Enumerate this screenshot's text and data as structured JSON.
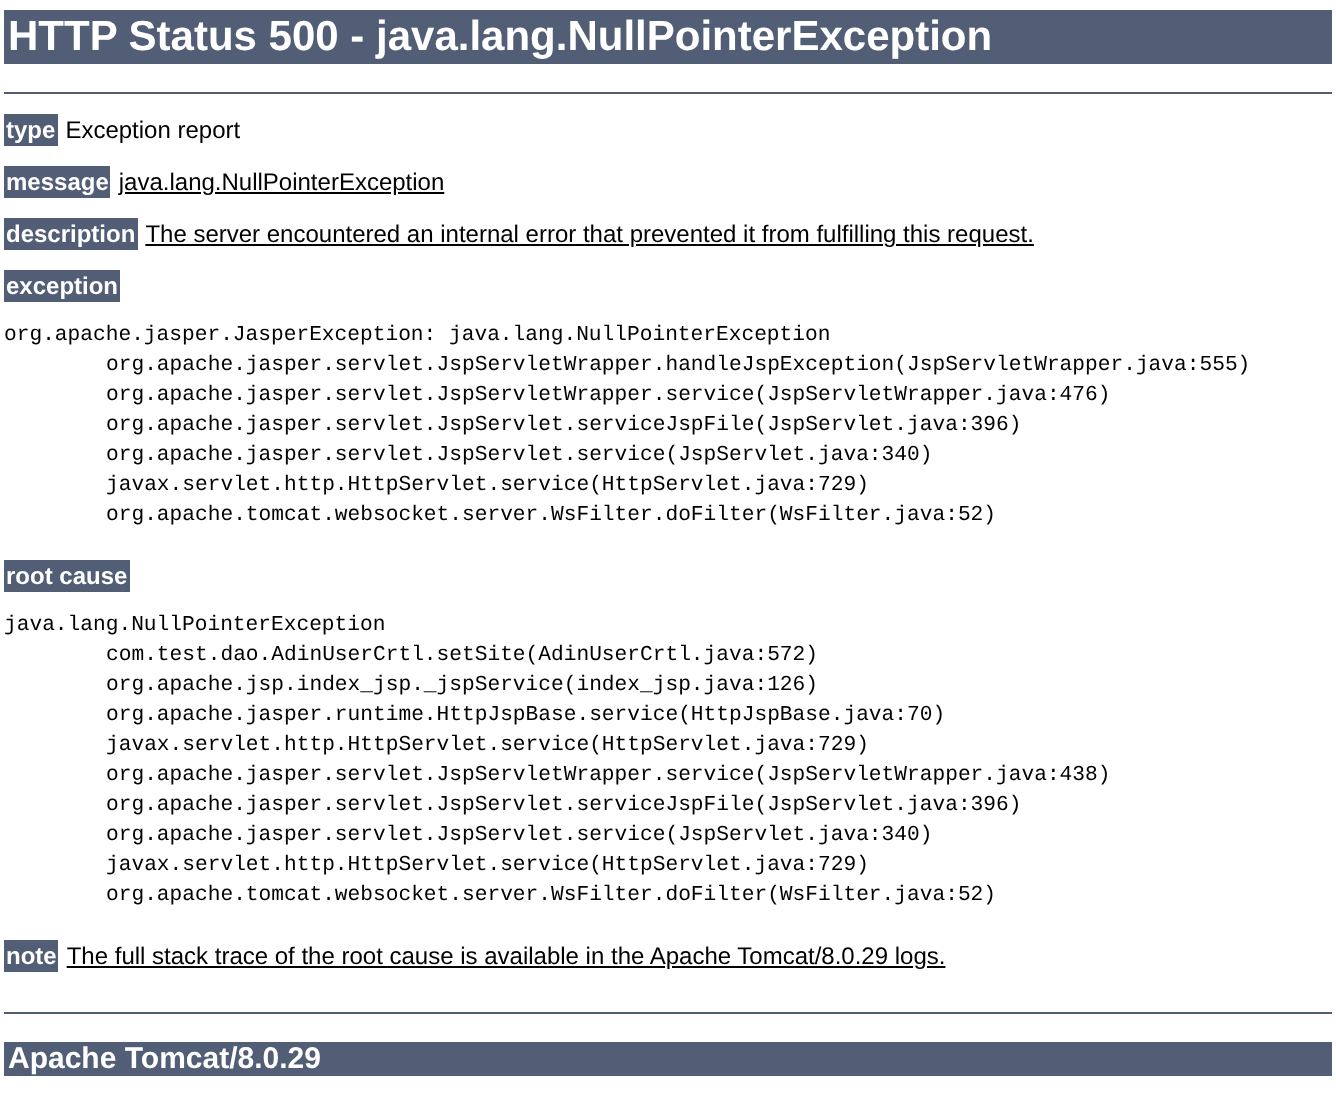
{
  "title": "HTTP Status 500 - java.lang.NullPointerException",
  "sections": [
    {
      "kind": "field",
      "label": "type",
      "value": "Exception report",
      "underlined": false
    },
    {
      "kind": "field",
      "label": "message",
      "value": "java.lang.NullPointerException",
      "underlined": true
    },
    {
      "kind": "field",
      "label": "description",
      "value": "The server encountered an internal error that prevented it from fulfilling this request.",
      "underlined": true
    },
    {
      "kind": "trace",
      "label": "exception",
      "head": "org.apache.jasper.JasperException: java.lang.NullPointerException",
      "frames": [
        "org.apache.jasper.servlet.JspServletWrapper.handleJspException(JspServletWrapper.java:555)",
        "org.apache.jasper.servlet.JspServletWrapper.service(JspServletWrapper.java:476)",
        "org.apache.jasper.servlet.JspServlet.serviceJspFile(JspServlet.java:396)",
        "org.apache.jasper.servlet.JspServlet.service(JspServlet.java:340)",
        "javax.servlet.http.HttpServlet.service(HttpServlet.java:729)",
        "org.apache.tomcat.websocket.server.WsFilter.doFilter(WsFilter.java:52)"
      ]
    },
    {
      "kind": "trace",
      "label": "root cause",
      "head": "java.lang.NullPointerException",
      "frames": [
        "com.test.dao.AdinUserCrtl.setSite(AdinUserCrtl.java:572)",
        "org.apache.jsp.index_jsp._jspService(index_jsp.java:126)",
        "org.apache.jasper.runtime.HttpJspBase.service(HttpJspBase.java:70)",
        "javax.servlet.http.HttpServlet.service(HttpServlet.java:729)",
        "org.apache.jasper.servlet.JspServletWrapper.service(JspServletWrapper.java:438)",
        "org.apache.jasper.servlet.JspServlet.serviceJspFile(JspServlet.java:396)",
        "org.apache.jasper.servlet.JspServlet.service(JspServlet.java:340)",
        "javax.servlet.http.HttpServlet.service(HttpServlet.java:729)",
        "org.apache.tomcat.websocket.server.WsFilter.doFilter(WsFilter.java:52)"
      ]
    },
    {
      "kind": "field",
      "label": "note",
      "value": "The full stack trace of the root cause is available in the Apache Tomcat/8.0.29 logs.",
      "underlined": true
    }
  ],
  "footer": "Apache Tomcat/8.0.29"
}
